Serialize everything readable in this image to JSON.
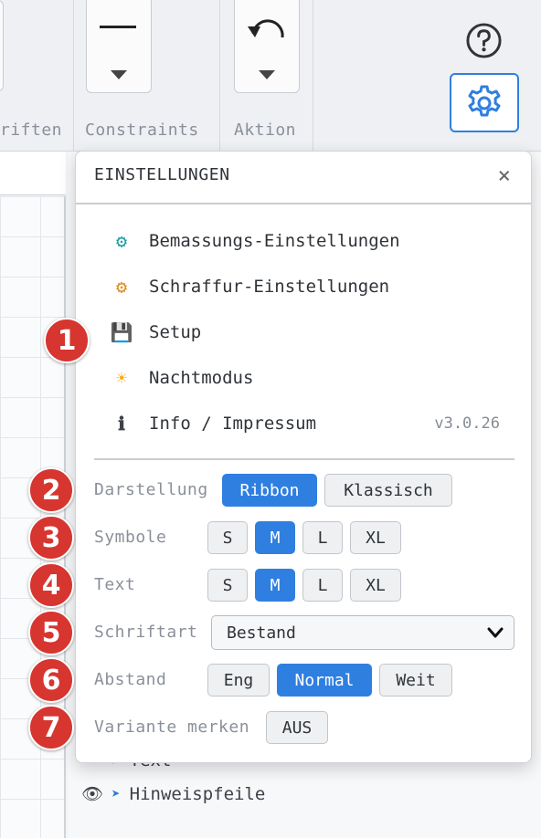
{
  "ribbon": {
    "groups": [
      {
        "label": "riften"
      },
      {
        "label": "Constraints"
      },
      {
        "label": "Aktion"
      }
    ]
  },
  "layers": [
    {
      "label": "Text"
    },
    {
      "label": "Hinweispfeile"
    }
  ],
  "settings": {
    "title": "EINSTELLUNGEN",
    "close": "×",
    "menu": [
      {
        "icon": "gear-icon",
        "glyph": "⚙",
        "color": "#1a9aa0",
        "label": "Bemassungs-Einstellungen"
      },
      {
        "icon": "gear-icon",
        "glyph": "⚙",
        "color": "#e08a1a",
        "label": "Schraffur-Einstellungen"
      },
      {
        "icon": "floppy-disk-icon",
        "glyph": "💾",
        "color": "#5a6b8a",
        "label": "Setup"
      },
      {
        "icon": "sun-icon",
        "glyph": "☀",
        "color": "#f2b01e",
        "label": "Nachtmodus"
      },
      {
        "icon": "info-icon",
        "glyph": "ℹ",
        "color": "#333333",
        "label": "Info / Impressum",
        "version": "v3.0.26"
      }
    ],
    "darstellung": {
      "label": "Darstellung",
      "options": [
        "Ribbon",
        "Klassisch"
      ],
      "selected": "Ribbon"
    },
    "symbole": {
      "label": "Symbole",
      "options": [
        "S",
        "M",
        "L",
        "XL"
      ],
      "selected": "M"
    },
    "text": {
      "label": "Text",
      "options": [
        "S",
        "M",
        "L",
        "XL"
      ],
      "selected": "M"
    },
    "schriftart": {
      "label": "Schriftart",
      "value": "Bestand"
    },
    "abstand": {
      "label": "Abstand",
      "options": [
        "Eng",
        "Normal",
        "Weit"
      ],
      "selected": "Normal"
    },
    "variante": {
      "label": "Variante merken",
      "value": "AUS"
    }
  },
  "badges": [
    "1",
    "2",
    "3",
    "4",
    "5",
    "6",
    "7"
  ],
  "colors": {
    "accent": "#2f7fe0",
    "badge": "#d7352f"
  }
}
